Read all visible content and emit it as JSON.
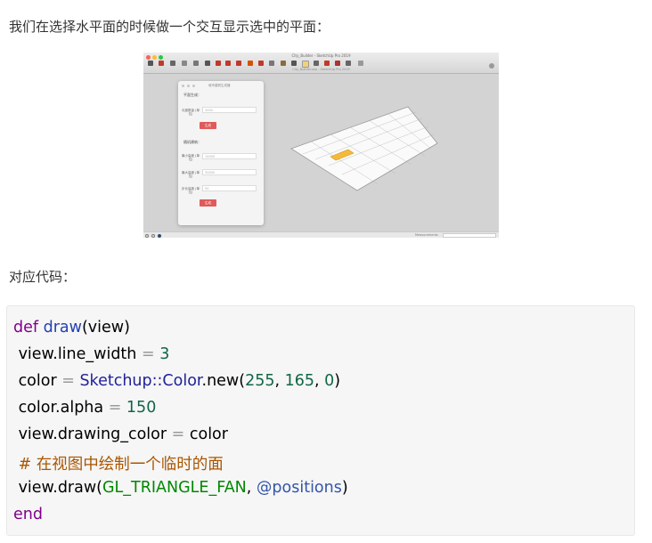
{
  "intro_text": "我们在选择水平面的时候做一个交互显示选中的平面：",
  "code_label": "对应代码：",
  "screenshot": {
    "window_title": "City_Builder - SketchUp Pro 2019",
    "file_name": "City_Builder.skp - SketchUp Pro 2019",
    "panel": {
      "title": "城市建筑生成器",
      "section1": "平面生成：",
      "field1_label": "长度数量 (单位)",
      "field1_value": "3000",
      "button1": "生成",
      "section2": "随机建筑：",
      "field2_label": "最小高度 (单位)",
      "field2_value": "10000",
      "field3_label": "最大高度 (单位)",
      "field3_value": "30000",
      "field4_label": "步长高度 (单位)",
      "field4_value": "50",
      "button2": "生成"
    },
    "measurements_label": "Measurements",
    "colors": {
      "close": "#ff5f57",
      "minimize": "#febc2e",
      "maximize": "#28c840",
      "panel_button": "#e05a5a",
      "highlight": "#f6b93b"
    }
  },
  "code": {
    "line1": {
      "kw": "def",
      "fn": "draw",
      "rest": "(view)"
    },
    "line2": {
      "a": " view.line_width ",
      "op": "=",
      "num": " 3"
    },
    "line3": {
      "a": " color ",
      "op": "=",
      "cls": " Sketchup::Color",
      "b": ".new(",
      "n1": "255",
      "c1": ", ",
      "n2": "165",
      "c2": ", ",
      "n3": "0",
      "end": ")"
    },
    "line4": {
      "a": " color.alpha ",
      "op": "=",
      "num": " 150"
    },
    "line5": {
      "a": " view.drawing_color ",
      "op": "=",
      "b": " color"
    },
    "line6": {
      "cmt": " # 在视图中绘制一个临时的面"
    },
    "line7": {
      "a": " view.draw(",
      "const": "GL_TRIANGLE_FAN",
      "b": ", ",
      "ivar": "@positions",
      "end": ")"
    },
    "line8": {
      "kw": "end"
    }
  }
}
